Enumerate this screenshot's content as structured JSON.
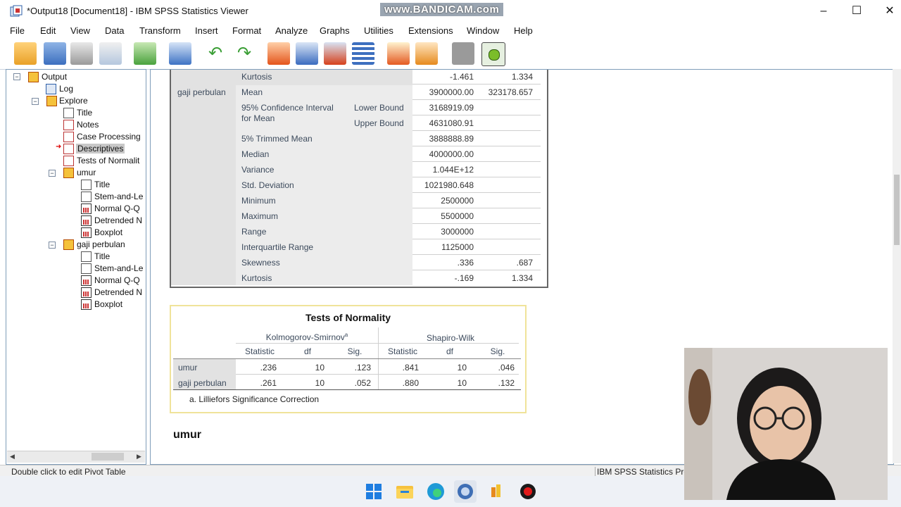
{
  "window": {
    "title": "*Output18 [Document18] - IBM SPSS Statistics Viewer",
    "watermark": "www.BANDICAM.com"
  },
  "menu": [
    "File",
    "Edit",
    "View",
    "Data",
    "Transform",
    "Insert",
    "Format",
    "Analyze",
    "Graphs",
    "Utilities",
    "Extensions",
    "Window",
    "Help"
  ],
  "toolbar_icons": [
    "open-icon",
    "save-icon",
    "print-icon",
    "print-preview-icon",
    "export-icon",
    "recall-dialog-icon",
    "undo-icon",
    "redo-icon",
    "goto-case-icon",
    "goto-variable-icon",
    "data-download-icon",
    "variables-icon",
    "designate-window-icon",
    "run-script-icon",
    "disabled-icon",
    "insert-icon"
  ],
  "nav": {
    "output": "Output",
    "log": "Log",
    "explore": "Explore",
    "explore_items": [
      "Title",
      "Notes",
      "Case Processing",
      "Descriptives",
      "Tests of Normalit"
    ],
    "umur": "umur",
    "umur_items": [
      "Title",
      "Stem-and-Le",
      "Normal Q-Q",
      "Detrended N",
      "Boxplot"
    ],
    "gaji": "gaji perbulan",
    "gaji_items": [
      "Title",
      "Stem-and-Le",
      "Normal Q-Q",
      "Detrended N",
      "Boxplot"
    ]
  },
  "descriptives": {
    "top_row": {
      "label": "Kurtosis",
      "stat": "-1.461",
      "se": "1.334"
    },
    "variable": "gaji perbulan",
    "ci_label": "95% Confidence Interval for Mean",
    "rows": [
      {
        "label": "Mean",
        "sub": "",
        "stat": "3900000.00",
        "se": "323178.657"
      },
      {
        "label": "",
        "sub": "Lower Bound",
        "stat": "3168919.09",
        "se": ""
      },
      {
        "label": "",
        "sub": "Upper Bound",
        "stat": "4631080.91",
        "se": ""
      },
      {
        "label": "5% Trimmed Mean",
        "sub": "",
        "stat": "3888888.89",
        "se": ""
      },
      {
        "label": "Median",
        "sub": "",
        "stat": "4000000.00",
        "se": ""
      },
      {
        "label": "Variance",
        "sub": "",
        "stat": "1.044E+12",
        "se": ""
      },
      {
        "label": "Std. Deviation",
        "sub": "",
        "stat": "1021980.648",
        "se": ""
      },
      {
        "label": "Minimum",
        "sub": "",
        "stat": "2500000",
        "se": ""
      },
      {
        "label": "Maximum",
        "sub": "",
        "stat": "5500000",
        "se": ""
      },
      {
        "label": "Range",
        "sub": "",
        "stat": "3000000",
        "se": ""
      },
      {
        "label": "Interquartile Range",
        "sub": "",
        "stat": "1125000",
        "se": ""
      },
      {
        "label": "Skewness",
        "sub": "",
        "stat": ".336",
        "se": ".687"
      },
      {
        "label": "Kurtosis",
        "sub": "",
        "stat": "-.169",
        "se": "1.334"
      }
    ]
  },
  "normality": {
    "title": "Tests of Normality",
    "ks_header": "Kolmogorov-Smirnov",
    "ks_sup": "a",
    "sw_header": "Shapiro-Wilk",
    "cols": [
      "Statistic",
      "df",
      "Sig.",
      "Statistic",
      "df",
      "Sig."
    ],
    "rows": [
      {
        "name": "umur",
        "vals": [
          ".236",
          "10",
          ".123",
          ".841",
          "10",
          ".046"
        ]
      },
      {
        "name": "gaji perbulan",
        "vals": [
          ".261",
          "10",
          ".052",
          ".880",
          "10",
          ".132"
        ]
      }
    ],
    "footnote": "a. Lilliefors Significance Correction"
  },
  "section_heading": "umur",
  "status": {
    "left": "Double click to edit Pivot Table",
    "right": "IBM SPSS Statistics Pro"
  }
}
